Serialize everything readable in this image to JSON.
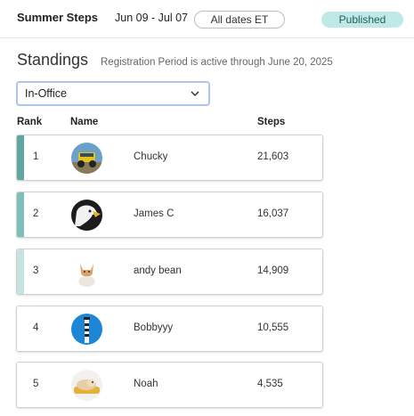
{
  "header": {
    "title": "Summer Steps",
    "date_range": "Jun 09 - Jul 07",
    "timezone_label": "All dates ET",
    "status": "Published",
    "status_color": "#bfe9e7"
  },
  "standings": {
    "title": "Standings",
    "note": "Registration Period is active through June 20, 2025",
    "filter": {
      "selected": "In-Office",
      "icon": "chevron-down-icon"
    },
    "columns": {
      "rank": "Rank",
      "name": "Name",
      "steps": "Steps"
    },
    "rows": [
      {
        "rank": "1",
        "name": "Chucky",
        "steps": "21,603",
        "accent": "#5fa8a2",
        "avatar": "jeep-avatar"
      },
      {
        "rank": "2",
        "name": "James C",
        "steps": "16,037",
        "accent": "#7fbfba",
        "avatar": "eagle-avatar"
      },
      {
        "rank": "3",
        "name": "andy bean",
        "steps": "14,909",
        "accent": "#c6e3e1",
        "avatar": "cat-avatar"
      },
      {
        "rank": "4",
        "name": "Bobbyyy",
        "steps": "10,555",
        "accent": "#ffffff",
        "avatar": "lighthouse-avatar"
      },
      {
        "rank": "5",
        "name": "Noah",
        "steps": "4,535",
        "accent": "#ffffff",
        "avatar": "dog-avatar"
      }
    ]
  }
}
